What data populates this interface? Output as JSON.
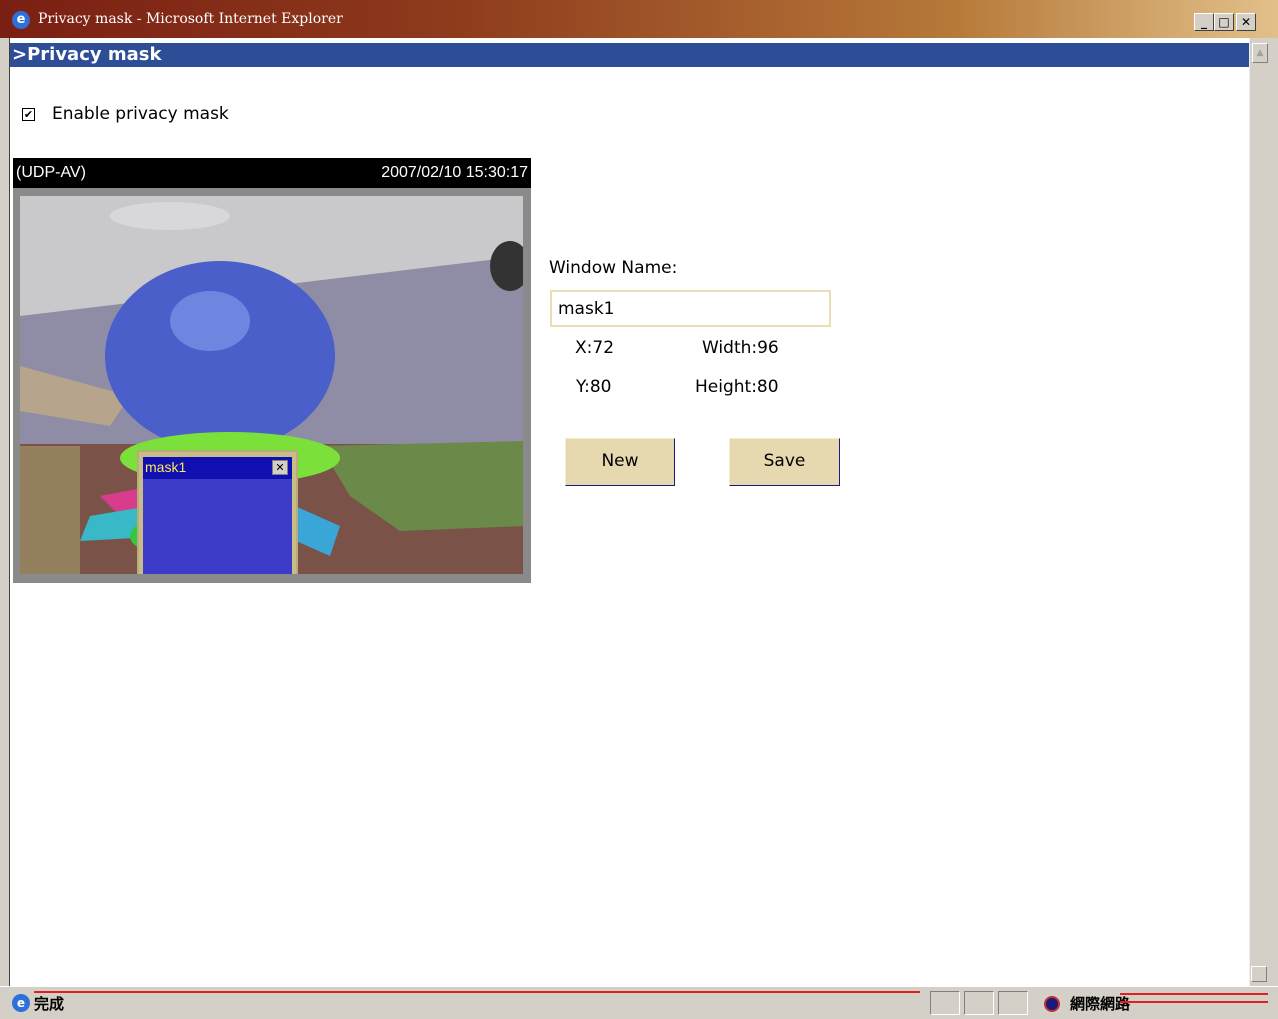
{
  "window": {
    "title": "Privacy mask - Microsoft Internet Explorer",
    "controls": {
      "minimize": "_",
      "maximize": "□",
      "close": "✕"
    }
  },
  "page": {
    "header": ">Privacy mask",
    "enable_checkbox": {
      "label": "Enable privacy mask",
      "checked": true,
      "mark": "✔"
    }
  },
  "video": {
    "protocol": "(UDP-AV)",
    "timestamp": "2007/02/10 15:30:17",
    "mask": {
      "name": "mask1",
      "close": "✕"
    }
  },
  "form": {
    "window_name_label": "Window Name:",
    "window_name_value": "mask1",
    "x": "X:72",
    "y": "Y:80",
    "width": "Width:96",
    "height": "Height:80",
    "new_button": "New",
    "save_button": "Save"
  },
  "statusbar": {
    "text": "完成",
    "zone": "網際網路"
  },
  "icons": {
    "app": "ie-icon",
    "status": "page-done-icon",
    "zone": "internet-zone-icon"
  }
}
